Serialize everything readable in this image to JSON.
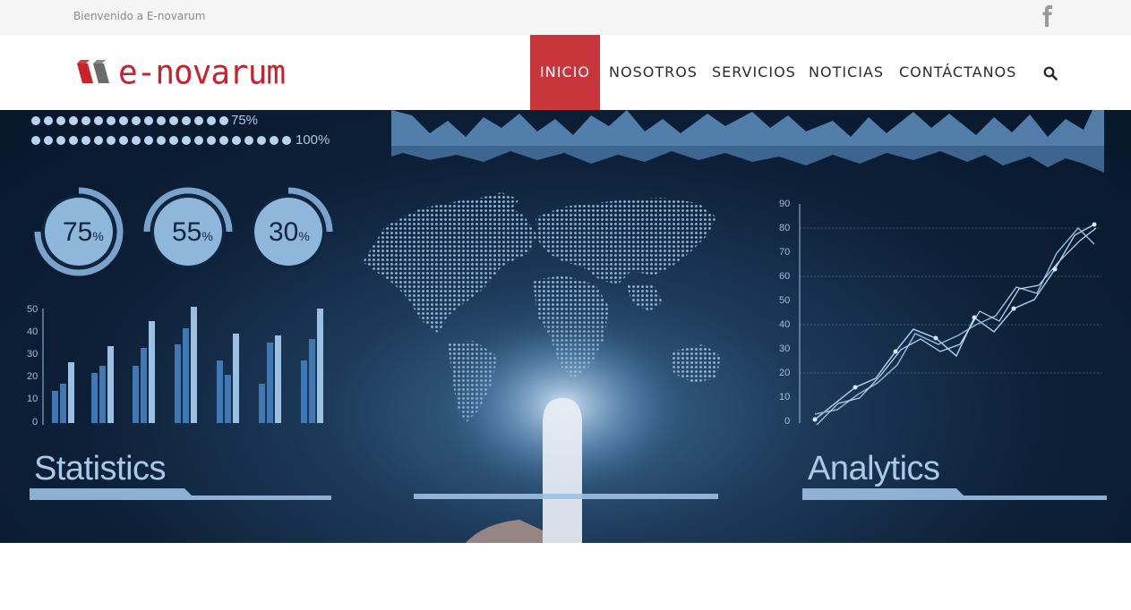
{
  "topbar": {
    "welcome": "Bienvenido a E-novarum",
    "social_icon": "facebook-icon"
  },
  "header": {
    "logo_text": "e-novarum",
    "brand_color": "#c8232c",
    "nav": [
      {
        "label": "INICIO",
        "active": true
      },
      {
        "label": "NOSOTROS",
        "active": false
      },
      {
        "label": "SERVICIOS",
        "active": false
      },
      {
        "label": "NOTICIAS",
        "active": false
      },
      {
        "label": "CONTÁCTANOS",
        "active": false
      }
    ],
    "search_icon": "search-icon",
    "active_color": "#c8363b"
  },
  "hero": {
    "dots_75": "75%",
    "dots_100": "100%",
    "gauges": [
      {
        "value": "75",
        "unit": "%"
      },
      {
        "value": "55",
        "unit": "%"
      },
      {
        "value": "30",
        "unit": "%"
      }
    ],
    "left_ticks": [
      "50",
      "40",
      "30",
      "20",
      "10",
      "0"
    ],
    "right_ticks": [
      "90",
      "80",
      "70",
      "60",
      "50",
      "40",
      "30",
      "20",
      "10",
      "0"
    ],
    "statistics_label": "Statistics",
    "analytics_label": "Analytics"
  }
}
